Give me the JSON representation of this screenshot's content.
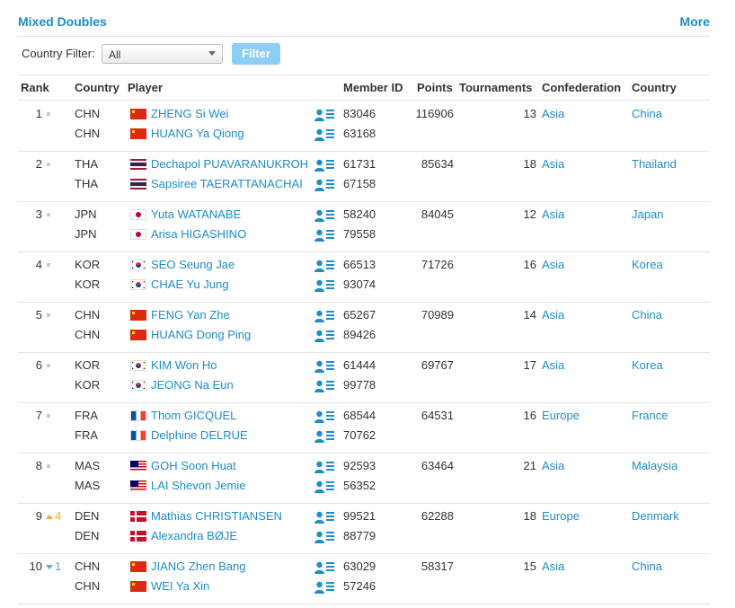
{
  "header": {
    "title": "Mixed Doubles",
    "more": "More"
  },
  "filter": {
    "label": "Country Filter:",
    "selected": "All",
    "button": "Filter"
  },
  "columns": {
    "rank": "Rank",
    "country": "Country",
    "player": "Player",
    "member_id": "Member ID",
    "points": "Points",
    "tournaments": "Tournaments",
    "confederation": "Confederation",
    "country_name": "Country"
  },
  "colors": {
    "accent": "#1e8cc8",
    "filter_button": "#8ccdf5",
    "up": "#f5a623",
    "down": "#5aa6d6"
  },
  "icons": {
    "player_profile": "player-profile-icon",
    "rank_dot": "rank-dot-icon"
  },
  "rows": [
    {
      "rank": "1",
      "move": "",
      "move_dir": "",
      "points": "116906",
      "tournaments": "13",
      "confederation": "Asia",
      "country": "China",
      "players": [
        {
          "code": "CHN",
          "flag": "chn",
          "name": "ZHENG Si Wei",
          "member_id": "83046"
        },
        {
          "code": "CHN",
          "flag": "chn",
          "name": "HUANG Ya Qiong",
          "member_id": "63168"
        }
      ]
    },
    {
      "rank": "2",
      "move": "",
      "move_dir": "",
      "points": "85634",
      "tournaments": "18",
      "confederation": "Asia",
      "country": "Thailand",
      "players": [
        {
          "code": "THA",
          "flag": "tha",
          "name": "Dechapol PUAVARANUKROH",
          "member_id": "61731"
        },
        {
          "code": "THA",
          "flag": "tha",
          "name": "Sapsiree TAERATTANACHAI",
          "member_id": "67158"
        }
      ]
    },
    {
      "rank": "3",
      "move": "",
      "move_dir": "",
      "points": "84045",
      "tournaments": "12",
      "confederation": "Asia",
      "country": "Japan",
      "players": [
        {
          "code": "JPN",
          "flag": "jpn",
          "name": "Yuta WATANABE",
          "member_id": "58240"
        },
        {
          "code": "JPN",
          "flag": "jpn",
          "name": "Arisa HIGASHINO",
          "member_id": "79558"
        }
      ]
    },
    {
      "rank": "4",
      "move": "",
      "move_dir": "",
      "points": "71726",
      "tournaments": "16",
      "confederation": "Asia",
      "country": "Korea",
      "players": [
        {
          "code": "KOR",
          "flag": "kor",
          "name": "SEO Seung Jae",
          "member_id": "66513"
        },
        {
          "code": "KOR",
          "flag": "kor",
          "name": "CHAE Yu Jung",
          "member_id": "93074"
        }
      ]
    },
    {
      "rank": "5",
      "move": "",
      "move_dir": "",
      "points": "70989",
      "tournaments": "14",
      "confederation": "Asia",
      "country": "China",
      "players": [
        {
          "code": "CHN",
          "flag": "chn",
          "name": "FENG Yan Zhe",
          "member_id": "65267"
        },
        {
          "code": "CHN",
          "flag": "chn",
          "name": "HUANG Dong Ping",
          "member_id": "89426"
        }
      ]
    },
    {
      "rank": "6",
      "move": "",
      "move_dir": "",
      "points": "69767",
      "tournaments": "17",
      "confederation": "Asia",
      "country": "Korea",
      "players": [
        {
          "code": "KOR",
          "flag": "kor",
          "name": "KIM Won Ho",
          "member_id": "61444"
        },
        {
          "code": "KOR",
          "flag": "kor",
          "name": "JEONG Na Eun",
          "member_id": "99778"
        }
      ]
    },
    {
      "rank": "7",
      "move": "",
      "move_dir": "",
      "points": "64531",
      "tournaments": "16",
      "confederation": "Europe",
      "country": "France",
      "players": [
        {
          "code": "FRA",
          "flag": "fra",
          "name": "Thom GICQUEL",
          "member_id": "68544"
        },
        {
          "code": "FRA",
          "flag": "fra",
          "name": "Delphine DELRUE",
          "member_id": "70762"
        }
      ]
    },
    {
      "rank": "8",
      "move": "",
      "move_dir": "",
      "points": "63464",
      "tournaments": "21",
      "confederation": "Asia",
      "country": "Malaysia",
      "players": [
        {
          "code": "MAS",
          "flag": "mas",
          "name": "GOH Soon Huat",
          "member_id": "92593"
        },
        {
          "code": "MAS",
          "flag": "mas",
          "name": "LAI Shevon Jemie",
          "member_id": "56352"
        }
      ]
    },
    {
      "rank": "9",
      "move": "4",
      "move_dir": "up",
      "points": "62288",
      "tournaments": "18",
      "confederation": "Europe",
      "country": "Denmark",
      "players": [
        {
          "code": "DEN",
          "flag": "den",
          "name": "Mathias CHRISTIANSEN",
          "member_id": "99521"
        },
        {
          "code": "DEN",
          "flag": "den",
          "name": "Alexandra BØJE",
          "member_id": "88779"
        }
      ]
    },
    {
      "rank": "10",
      "move": "1",
      "move_dir": "down",
      "points": "58317",
      "tournaments": "15",
      "confederation": "Asia",
      "country": "China",
      "players": [
        {
          "code": "CHN",
          "flag": "chn",
          "name": "JIANG Zhen Bang",
          "member_id": "63029"
        },
        {
          "code": "CHN",
          "flag": "chn",
          "name": "WEI Ya Xin",
          "member_id": "57246"
        }
      ]
    }
  ]
}
